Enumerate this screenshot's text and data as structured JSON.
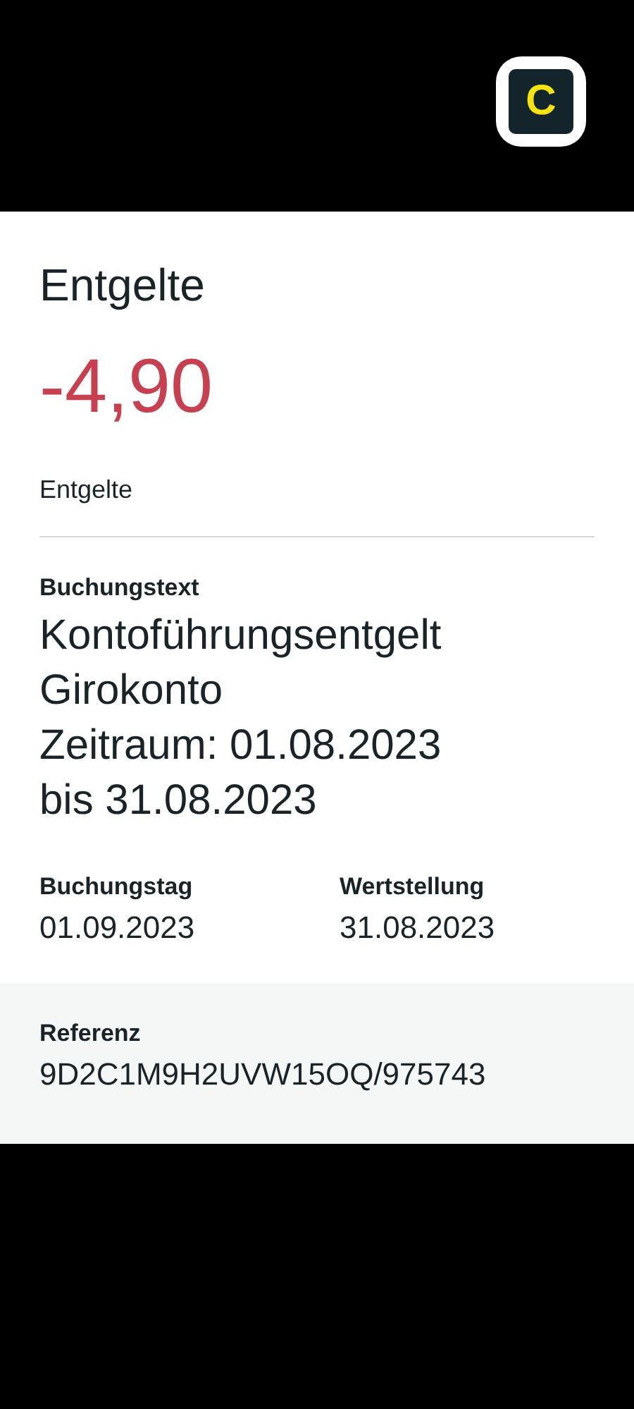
{
  "app_badge": {
    "letter": "C"
  },
  "transaction": {
    "title": "Entgelte",
    "amount": "-4,90",
    "category": "Entgelte"
  },
  "booking_text": {
    "label": "Buchungstext",
    "lines": [
      "Kontoführungsentgelt",
      "Girokonto",
      "Zeitraum: 01.08.2023",
      "bis 31.08.2023"
    ]
  },
  "dates": [
    {
      "label": "Buchungstag",
      "value": "01.09.2023"
    },
    {
      "label": "Wertstellung",
      "value": "31.08.2023"
    }
  ],
  "reference": {
    "label": "Referenz",
    "value": "9D2C1M9H2UVW15OQ/975743"
  }
}
